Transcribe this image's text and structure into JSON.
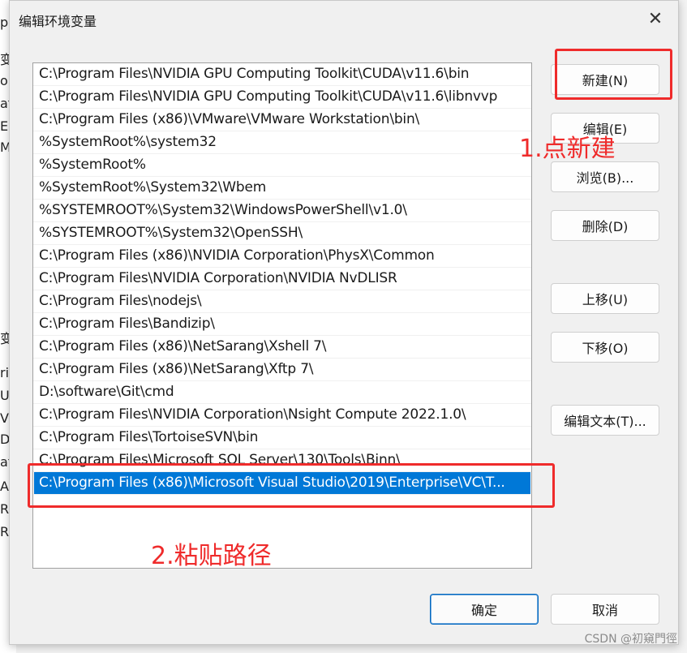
{
  "background": {
    "fragments": [
      "p",
      "变",
      "on",
      "at",
      "E",
      "M",
      "变",
      "ri",
      "U",
      "V",
      "D",
      "at",
      "A",
      "R",
      "R"
    ]
  },
  "dialog": {
    "title": "编辑环境变量",
    "close_label": "✕"
  },
  "paths": [
    "C:\\Program Files\\NVIDIA GPU Computing Toolkit\\CUDA\\v11.6\\bin",
    "C:\\Program Files\\NVIDIA GPU Computing Toolkit\\CUDA\\v11.6\\libnvvp",
    "C:\\Program Files (x86)\\VMware\\VMware Workstation\\bin\\",
    "%SystemRoot%\\system32",
    "%SystemRoot%",
    "%SystemRoot%\\System32\\Wbem",
    "%SYSTEMROOT%\\System32\\WindowsPowerShell\\v1.0\\",
    "%SYSTEMROOT%\\System32\\OpenSSH\\",
    "C:\\Program Files (x86)\\NVIDIA Corporation\\PhysX\\Common",
    "C:\\Program Files\\NVIDIA Corporation\\NVIDIA NvDLISR",
    "C:\\Program Files\\nodejs\\",
    "C:\\Program Files\\Bandizip\\",
    "C:\\Program Files (x86)\\NetSarang\\Xshell 7\\",
    "C:\\Program Files (x86)\\NetSarang\\Xftp 7\\",
    "D:\\software\\Git\\cmd",
    "C:\\Program Files\\NVIDIA Corporation\\Nsight Compute 2022.1.0\\",
    "C:\\Program Files\\TortoiseSVN\\bin",
    "C:\\Program Files\\Microsoft SQL Server\\130\\Tools\\Binn\\",
    "C:\\Program Files (x86)\\Microsoft Visual Studio\\2019\\Enterprise\\VC\\T..."
  ],
  "selected_index": 18,
  "buttons": {
    "new": "新建(N)",
    "edit": "编辑(E)",
    "browse": "浏览(B)...",
    "delete": "删除(D)",
    "move_up": "上移(U)",
    "move_down": "下移(O)",
    "edit_text": "编辑文本(T)...",
    "ok": "确定",
    "cancel": "取消"
  },
  "annotations": {
    "step1": "1.点新建",
    "step2": "2.粘贴路径",
    "color": "#ef2b2b"
  },
  "watermark": "CSDN @初窺門徑",
  "colors": {
    "selection": "#0078d7",
    "primary_border": "#0067c0"
  }
}
